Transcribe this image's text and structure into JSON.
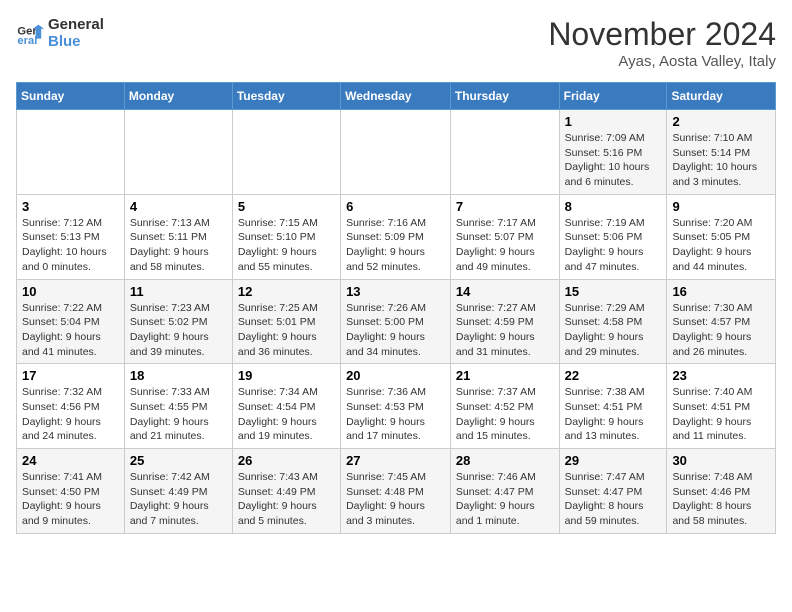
{
  "logo": {
    "line1": "General",
    "line2": "Blue"
  },
  "header": {
    "month": "November 2024",
    "location": "Ayas, Aosta Valley, Italy"
  },
  "weekdays": [
    "Sunday",
    "Monday",
    "Tuesday",
    "Wednesday",
    "Thursday",
    "Friday",
    "Saturday"
  ],
  "weeks": [
    [
      {
        "day": "",
        "info": ""
      },
      {
        "day": "",
        "info": ""
      },
      {
        "day": "",
        "info": ""
      },
      {
        "day": "",
        "info": ""
      },
      {
        "day": "",
        "info": ""
      },
      {
        "day": "1",
        "info": "Sunrise: 7:09 AM\nSunset: 5:16 PM\nDaylight: 10 hours\nand 6 minutes."
      },
      {
        "day": "2",
        "info": "Sunrise: 7:10 AM\nSunset: 5:14 PM\nDaylight: 10 hours\nand 3 minutes."
      }
    ],
    [
      {
        "day": "3",
        "info": "Sunrise: 7:12 AM\nSunset: 5:13 PM\nDaylight: 10 hours\nand 0 minutes."
      },
      {
        "day": "4",
        "info": "Sunrise: 7:13 AM\nSunset: 5:11 PM\nDaylight: 9 hours\nand 58 minutes."
      },
      {
        "day": "5",
        "info": "Sunrise: 7:15 AM\nSunset: 5:10 PM\nDaylight: 9 hours\nand 55 minutes."
      },
      {
        "day": "6",
        "info": "Sunrise: 7:16 AM\nSunset: 5:09 PM\nDaylight: 9 hours\nand 52 minutes."
      },
      {
        "day": "7",
        "info": "Sunrise: 7:17 AM\nSunset: 5:07 PM\nDaylight: 9 hours\nand 49 minutes."
      },
      {
        "day": "8",
        "info": "Sunrise: 7:19 AM\nSunset: 5:06 PM\nDaylight: 9 hours\nand 47 minutes."
      },
      {
        "day": "9",
        "info": "Sunrise: 7:20 AM\nSunset: 5:05 PM\nDaylight: 9 hours\nand 44 minutes."
      }
    ],
    [
      {
        "day": "10",
        "info": "Sunrise: 7:22 AM\nSunset: 5:04 PM\nDaylight: 9 hours\nand 41 minutes."
      },
      {
        "day": "11",
        "info": "Sunrise: 7:23 AM\nSunset: 5:02 PM\nDaylight: 9 hours\nand 39 minutes."
      },
      {
        "day": "12",
        "info": "Sunrise: 7:25 AM\nSunset: 5:01 PM\nDaylight: 9 hours\nand 36 minutes."
      },
      {
        "day": "13",
        "info": "Sunrise: 7:26 AM\nSunset: 5:00 PM\nDaylight: 9 hours\nand 34 minutes."
      },
      {
        "day": "14",
        "info": "Sunrise: 7:27 AM\nSunset: 4:59 PM\nDaylight: 9 hours\nand 31 minutes."
      },
      {
        "day": "15",
        "info": "Sunrise: 7:29 AM\nSunset: 4:58 PM\nDaylight: 9 hours\nand 29 minutes."
      },
      {
        "day": "16",
        "info": "Sunrise: 7:30 AM\nSunset: 4:57 PM\nDaylight: 9 hours\nand 26 minutes."
      }
    ],
    [
      {
        "day": "17",
        "info": "Sunrise: 7:32 AM\nSunset: 4:56 PM\nDaylight: 9 hours\nand 24 minutes."
      },
      {
        "day": "18",
        "info": "Sunrise: 7:33 AM\nSunset: 4:55 PM\nDaylight: 9 hours\nand 21 minutes."
      },
      {
        "day": "19",
        "info": "Sunrise: 7:34 AM\nSunset: 4:54 PM\nDaylight: 9 hours\nand 19 minutes."
      },
      {
        "day": "20",
        "info": "Sunrise: 7:36 AM\nSunset: 4:53 PM\nDaylight: 9 hours\nand 17 minutes."
      },
      {
        "day": "21",
        "info": "Sunrise: 7:37 AM\nSunset: 4:52 PM\nDaylight: 9 hours\nand 15 minutes."
      },
      {
        "day": "22",
        "info": "Sunrise: 7:38 AM\nSunset: 4:51 PM\nDaylight: 9 hours\nand 13 minutes."
      },
      {
        "day": "23",
        "info": "Sunrise: 7:40 AM\nSunset: 4:51 PM\nDaylight: 9 hours\nand 11 minutes."
      }
    ],
    [
      {
        "day": "24",
        "info": "Sunrise: 7:41 AM\nSunset: 4:50 PM\nDaylight: 9 hours\nand 9 minutes."
      },
      {
        "day": "25",
        "info": "Sunrise: 7:42 AM\nSunset: 4:49 PM\nDaylight: 9 hours\nand 7 minutes."
      },
      {
        "day": "26",
        "info": "Sunrise: 7:43 AM\nSunset: 4:49 PM\nDaylight: 9 hours\nand 5 minutes."
      },
      {
        "day": "27",
        "info": "Sunrise: 7:45 AM\nSunset: 4:48 PM\nDaylight: 9 hours\nand 3 minutes."
      },
      {
        "day": "28",
        "info": "Sunrise: 7:46 AM\nSunset: 4:47 PM\nDaylight: 9 hours\nand 1 minute."
      },
      {
        "day": "29",
        "info": "Sunrise: 7:47 AM\nSunset: 4:47 PM\nDaylight: 8 hours\nand 59 minutes."
      },
      {
        "day": "30",
        "info": "Sunrise: 7:48 AM\nSunset: 4:46 PM\nDaylight: 8 hours\nand 58 minutes."
      }
    ]
  ]
}
